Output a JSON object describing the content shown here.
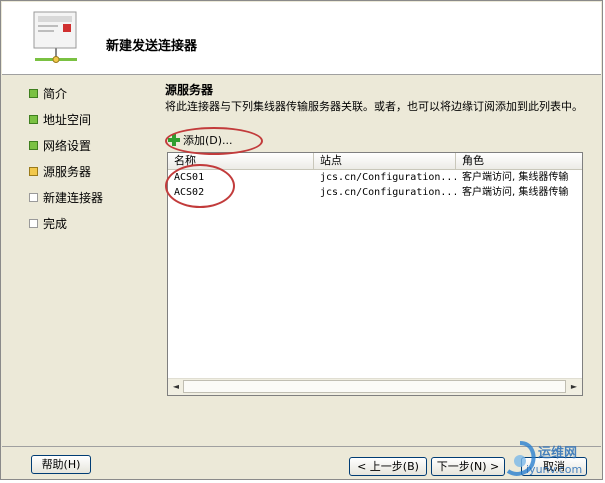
{
  "window": {
    "title": "新建发送连接器"
  },
  "nav": {
    "items": [
      {
        "label": "简介",
        "state": "done"
      },
      {
        "label": "地址空间",
        "state": "done"
      },
      {
        "label": "网络设置",
        "state": "done"
      },
      {
        "label": "源服务器",
        "state": "current"
      },
      {
        "label": "新建连接器",
        "state": "todo"
      },
      {
        "label": "完成",
        "state": "todo"
      }
    ]
  },
  "main": {
    "section_title": "源服务器",
    "description": "将此连接器与下列集线器传输服务器关联。或者，也可以将边缘订阅添加到此列表中。",
    "add_label": "添加(D)...",
    "columns": [
      "名称",
      "站点",
      "角色"
    ],
    "rows": [
      {
        "name": "ACS01",
        "site": "jcs.cn/Configuration...",
        "role": "客户端访问, 集线器传输"
      },
      {
        "name": "ACS02",
        "site": "jcs.cn/Configuration...",
        "role": "客户端访问, 集线器传输"
      }
    ],
    "scroll_left": "◄",
    "scroll_right": "►"
  },
  "footer": {
    "help": "帮助(H)",
    "back": "< 上一步(B)",
    "next": "下一步(N) >",
    "cancel": "取消"
  },
  "watermark": {
    "text": "运维网",
    "sub": "iyunv.com"
  },
  "colors": {
    "accent": "#c23b3b",
    "done": "#7ac142",
    "current": "#f2c84b"
  }
}
